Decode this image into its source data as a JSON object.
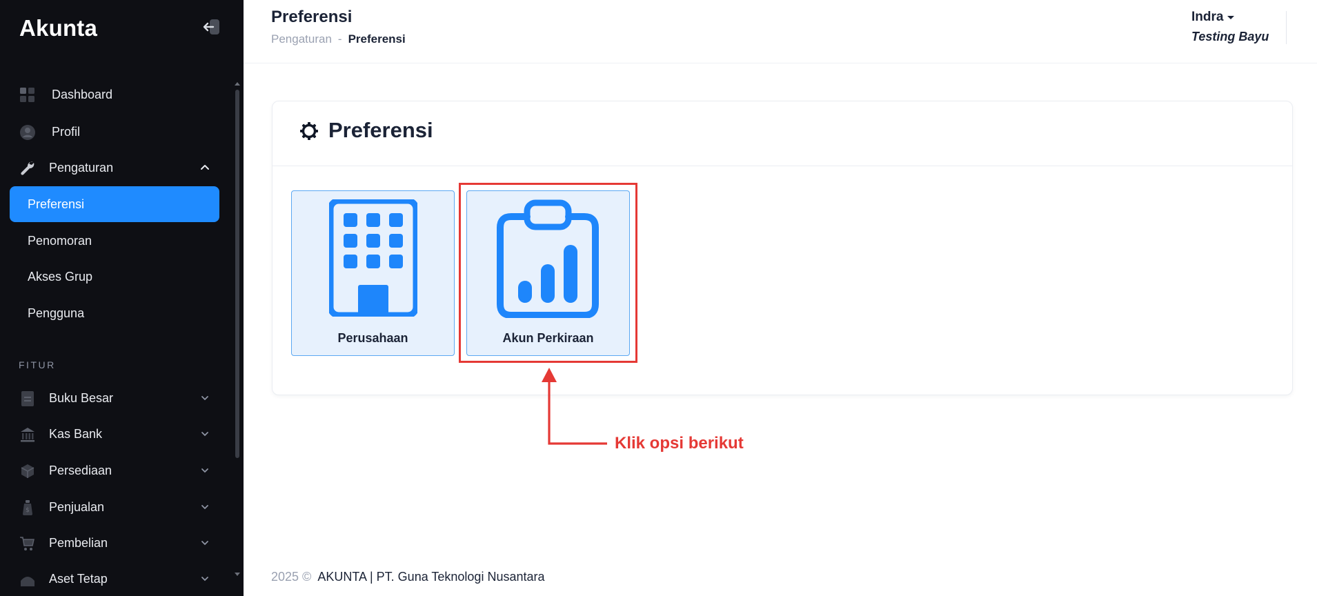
{
  "app": {
    "brand": "Akunta"
  },
  "sidebar": {
    "main_items": [
      {
        "label": "Dashboard",
        "icon": "dashboard-icon"
      },
      {
        "label": "Profil",
        "icon": "user-icon"
      },
      {
        "label": "Pengaturan",
        "icon": "wrench-icon",
        "expanded": true
      }
    ],
    "sub_items": [
      {
        "label": "Preferensi",
        "active": true
      },
      {
        "label": "Penomoran"
      },
      {
        "label": "Akses Grup"
      },
      {
        "label": "Pengguna"
      }
    ],
    "section_label": "FITUR",
    "feature_items": [
      {
        "label": "Buku Besar",
        "icon": "ledger-icon"
      },
      {
        "label": "Kas Bank",
        "icon": "bank-icon"
      },
      {
        "label": "Persediaan",
        "icon": "box-icon"
      },
      {
        "label": "Penjualan",
        "icon": "money-bag-icon"
      },
      {
        "label": "Pembelian",
        "icon": "cart-icon"
      },
      {
        "label": "Aset Tetap",
        "icon": "asset-icon"
      }
    ]
  },
  "header": {
    "title": "Preferensi",
    "breadcrumb": {
      "parent": "Pengaturan",
      "separator": "-",
      "current": "Preferensi"
    },
    "user": {
      "name": "Indra",
      "company": "Testing Bayu"
    }
  },
  "card": {
    "title": "Preferensi",
    "title_icon": "gear-icon",
    "tiles": [
      {
        "label": "Perusahaan",
        "icon": "building-icon"
      },
      {
        "label": "Akun Perkiraan",
        "icon": "clipboard-chart-icon"
      }
    ]
  },
  "annotation": {
    "text": "Klik opsi berikut",
    "color": "#e53935"
  },
  "footer": {
    "year": "2025 ©",
    "text": "AKUNTA | PT. Guna Teknologi Nusantara"
  },
  "colors": {
    "accent": "#1f8bff",
    "sidebar_bg": "#0e0f14",
    "tile_bg": "#e7f1fd",
    "icon_blue": "#1e86fb"
  }
}
